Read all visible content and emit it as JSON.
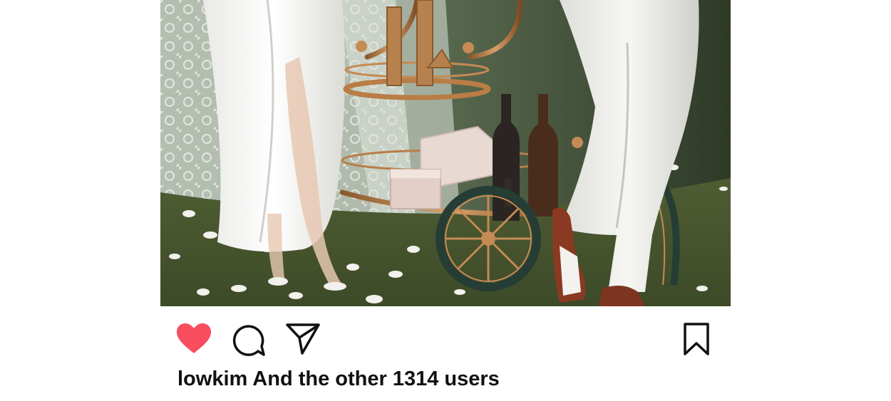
{
  "post": {
    "photo_subject": "wedding-couple-bar-cart",
    "likes": {
      "username": "lowkim",
      "text": "And the other 1314 users"
    }
  },
  "actions": {
    "like_icon": "heart-filled-icon",
    "comment_icon": "speech-bubble-icon",
    "share_icon": "paper-plane-icon",
    "save_icon": "bookmark-icon",
    "liked": true
  },
  "colors": {
    "heart": "#f84d5e",
    "icon_stroke": "#111111",
    "text": "#111111",
    "background": "#ffffff"
  }
}
